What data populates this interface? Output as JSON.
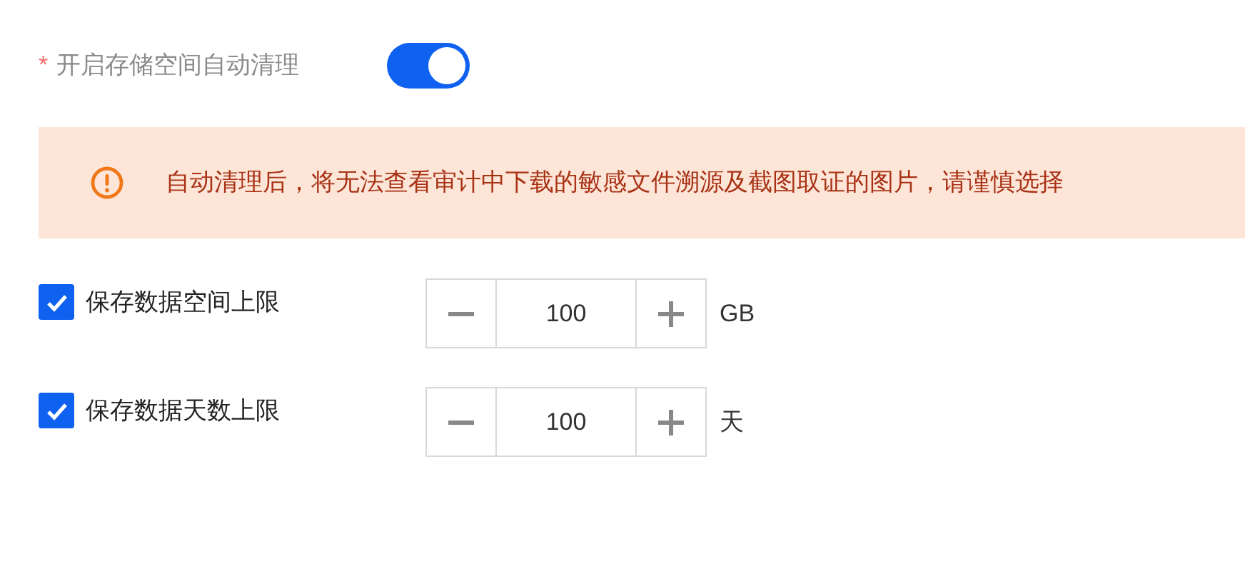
{
  "setting": {
    "required_mark": "*",
    "label": "开启存储空间自动清理",
    "on": true
  },
  "alert": {
    "text": "自动清理后，将无法查看审计中下载的敏感文件溯源及截图取证的图片，请谨慎选择"
  },
  "limits": [
    {
      "checked": true,
      "label": "保存数据空间上限",
      "value": "100",
      "unit": "GB"
    },
    {
      "checked": true,
      "label": "保存数据天数上限",
      "value": "100",
      "unit": "天"
    }
  ]
}
